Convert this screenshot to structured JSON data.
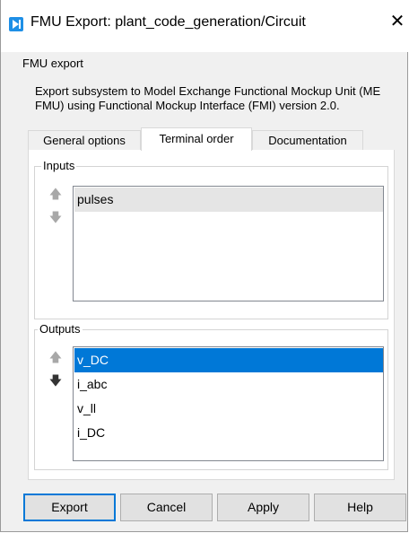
{
  "window": {
    "title": "FMU Export: plant_code_generation/Circuit",
    "close_glyph": "✕"
  },
  "fmu_export_group": {
    "label": "FMU export",
    "description": "Export subsystem to Model Exchange Functional Mockup Unit (ME FMU) using Functional Mockup Interface (FMI) version 2.0."
  },
  "tabs": [
    {
      "label": "General options",
      "active": false
    },
    {
      "label": "Terminal order",
      "active": true
    },
    {
      "label": "Documentation",
      "active": false
    }
  ],
  "inputs": {
    "label": "Inputs",
    "items": [
      "pulses"
    ],
    "selected": "pulses",
    "up_icon": "arrow-up-icon",
    "down_icon": "arrow-down-icon"
  },
  "outputs": {
    "label": "Outputs",
    "items": [
      "v_DC",
      "i_abc",
      "v_ll",
      "i_DC"
    ],
    "selected": "v_DC",
    "up_icon": "arrow-up-icon",
    "down_icon": "arrow-down-icon"
  },
  "buttons": {
    "export": "Export",
    "cancel": "Cancel",
    "apply": "Apply",
    "help": "Help"
  },
  "colors": {
    "selection": "#0078d7",
    "inactive_selection": "#e5e5e5",
    "app_icon": "#1e8fe6"
  }
}
